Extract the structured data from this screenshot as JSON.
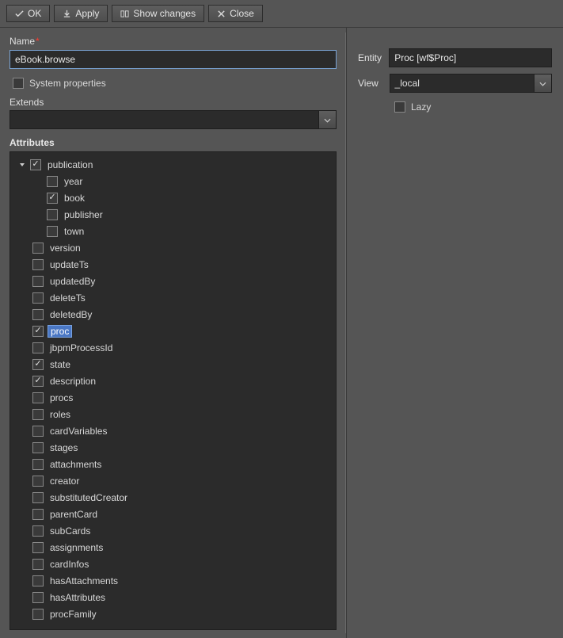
{
  "toolbar": {
    "ok": "OK",
    "apply": "Apply",
    "show_changes": "Show changes",
    "close": "Close"
  },
  "left": {
    "name_label": "Name",
    "name_value": "eBook.browse",
    "system_properties_label": "System properties",
    "system_properties_checked": false,
    "extends_label": "Extends",
    "extends_value": "",
    "attributes_label": "Attributes",
    "tree": [
      {
        "label": "publication",
        "checked": true,
        "indent": 0,
        "expanded": true,
        "selected": false
      },
      {
        "label": "year",
        "checked": false,
        "indent": 2,
        "expanded": null,
        "selected": false
      },
      {
        "label": "book",
        "checked": true,
        "indent": 2,
        "expanded": null,
        "selected": false
      },
      {
        "label": "publisher",
        "checked": false,
        "indent": 2,
        "expanded": null,
        "selected": false
      },
      {
        "label": "town",
        "checked": false,
        "indent": 2,
        "expanded": null,
        "selected": false
      },
      {
        "label": "version",
        "checked": false,
        "indent": 1,
        "expanded": null,
        "selected": false
      },
      {
        "label": "updateTs",
        "checked": false,
        "indent": 1,
        "expanded": null,
        "selected": false
      },
      {
        "label": "updatedBy",
        "checked": false,
        "indent": 1,
        "expanded": null,
        "selected": false
      },
      {
        "label": "deleteTs",
        "checked": false,
        "indent": 1,
        "expanded": null,
        "selected": false
      },
      {
        "label": "deletedBy",
        "checked": false,
        "indent": 1,
        "expanded": null,
        "selected": false
      },
      {
        "label": "proc",
        "checked": true,
        "indent": 1,
        "expanded": null,
        "selected": true
      },
      {
        "label": "jbpmProcessId",
        "checked": false,
        "indent": 1,
        "expanded": null,
        "selected": false
      },
      {
        "label": "state",
        "checked": true,
        "indent": 1,
        "expanded": null,
        "selected": false
      },
      {
        "label": "description",
        "checked": true,
        "indent": 1,
        "expanded": null,
        "selected": false
      },
      {
        "label": "procs",
        "checked": false,
        "indent": 1,
        "expanded": null,
        "selected": false
      },
      {
        "label": "roles",
        "checked": false,
        "indent": 1,
        "expanded": null,
        "selected": false
      },
      {
        "label": "cardVariables",
        "checked": false,
        "indent": 1,
        "expanded": null,
        "selected": false
      },
      {
        "label": "stages",
        "checked": false,
        "indent": 1,
        "expanded": null,
        "selected": false
      },
      {
        "label": "attachments",
        "checked": false,
        "indent": 1,
        "expanded": null,
        "selected": false
      },
      {
        "label": "creator",
        "checked": false,
        "indent": 1,
        "expanded": null,
        "selected": false
      },
      {
        "label": "substitutedCreator",
        "checked": false,
        "indent": 1,
        "expanded": null,
        "selected": false
      },
      {
        "label": "parentCard",
        "checked": false,
        "indent": 1,
        "expanded": null,
        "selected": false
      },
      {
        "label": "subCards",
        "checked": false,
        "indent": 1,
        "expanded": null,
        "selected": false
      },
      {
        "label": "assignments",
        "checked": false,
        "indent": 1,
        "expanded": null,
        "selected": false
      },
      {
        "label": "cardInfos",
        "checked": false,
        "indent": 1,
        "expanded": null,
        "selected": false
      },
      {
        "label": "hasAttachments",
        "checked": false,
        "indent": 1,
        "expanded": null,
        "selected": false
      },
      {
        "label": "hasAttributes",
        "checked": false,
        "indent": 1,
        "expanded": null,
        "selected": false
      },
      {
        "label": "procFamily",
        "checked": false,
        "indent": 1,
        "expanded": null,
        "selected": false
      }
    ]
  },
  "right": {
    "entity_label": "Entity",
    "entity_value": "Proc [wf$Proc]",
    "view_label": "View",
    "view_value": "_local",
    "lazy_label": "Lazy",
    "lazy_checked": false
  }
}
